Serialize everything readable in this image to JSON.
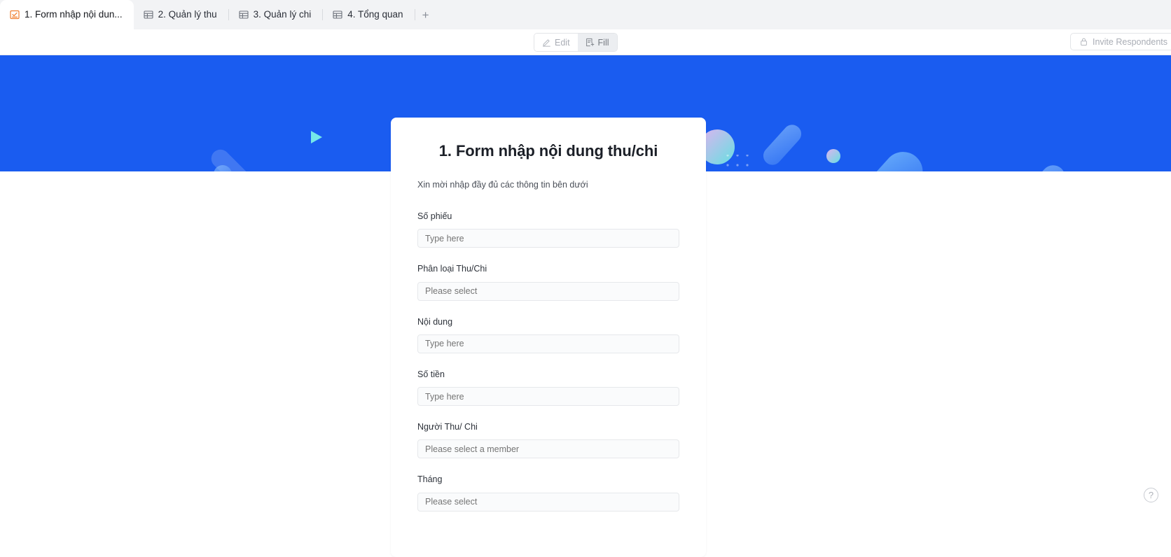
{
  "tabs": [
    {
      "label": "1. Form nhập nội dun...",
      "icon": "form-icon",
      "active": true
    },
    {
      "label": "2. Quản lý thu",
      "icon": "table-icon",
      "active": false
    },
    {
      "label": "3. Quản lý chi",
      "icon": "table-icon",
      "active": false
    },
    {
      "label": "4. Tổng quan",
      "icon": "table-icon",
      "active": false
    }
  ],
  "tab_add_label": "+",
  "toolbar": {
    "edit_label": "Edit",
    "edit_icon": "pencil-icon",
    "fill_label": "Fill",
    "fill_icon": "form-fill-icon",
    "fill_selected": true,
    "invite_label": "Invite Respondents",
    "invite_icon": "lock-icon"
  },
  "banner": {
    "background_color": "#1a5cf0"
  },
  "form": {
    "title": "1. Form nhập nội dung thu/chi",
    "subtitle": "Xin mời nhập đầy đủ các thông tin bên dưới",
    "fields": [
      {
        "label": "Số phiếu",
        "placeholder": "Type here",
        "type": "text"
      },
      {
        "label": "Phân loại Thu/Chi",
        "placeholder": "Please select",
        "type": "select"
      },
      {
        "label": "Nội dung",
        "placeholder": "Type here",
        "type": "text"
      },
      {
        "label": "Số tiền",
        "placeholder": "Type here",
        "type": "text"
      },
      {
        "label": "Người Thu/ Chi",
        "placeholder": "Please select a member",
        "type": "select"
      },
      {
        "label": "Tháng",
        "placeholder": "Please select",
        "type": "select"
      }
    ]
  },
  "help": {
    "label": "?",
    "icon": "question-mark-icon"
  },
  "colors": {
    "brand_blue": "#1a5cf0",
    "tab_active_bg": "#ffffff",
    "tabbar_bg": "#f2f3f5",
    "input_bg": "#fafbfc",
    "placeholder": "#a2a7b0"
  }
}
